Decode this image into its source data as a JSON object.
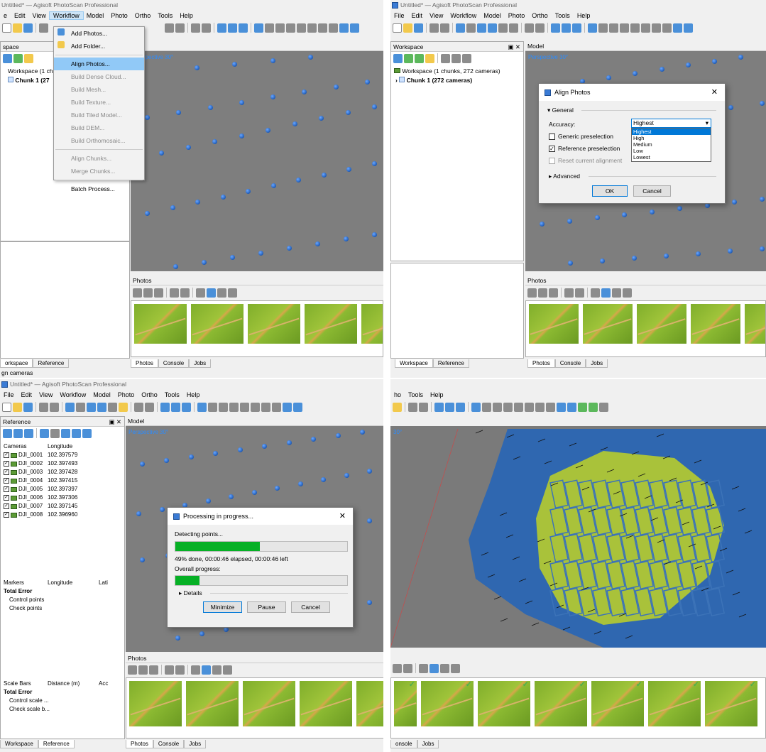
{
  "q1": {
    "title": "Untitled* — Agisoft PhotoScan Professional",
    "menu": [
      "e",
      "Edit",
      "View",
      "Workflow",
      "Model",
      "Photo",
      "Ortho",
      "Tools",
      "Help"
    ],
    "workspace_header": "space",
    "workspace_item": "Workspace (1 ch",
    "chunk_item": "Chunk 1 (27",
    "model_tab": "del",
    "perspective": "Perspective 30°",
    "photos_header": "Photos",
    "bottom_tabs_left": [
      "orkspace",
      "Reference"
    ],
    "bottom_tabs_right": [
      "Photos",
      "Console",
      "Jobs"
    ],
    "status": "gn cameras",
    "workflow_menu": {
      "add_photos": "Add Photos...",
      "add_folder": "Add Folder...",
      "align_photos": "Align Photos...",
      "build_dense": "Build Dense Cloud...",
      "build_mesh": "Build Mesh...",
      "build_texture": "Build Texture...",
      "build_tiled": "Build Tiled Model...",
      "build_dem": "Build DEM...",
      "build_ortho": "Build Orthomosaic...",
      "align_chunks": "Align Chunks...",
      "merge_chunks": "Merge Chunks...",
      "batch": "Batch Process..."
    }
  },
  "q2": {
    "title": "Untitled* — Agisoft PhotoScan Professional",
    "menu": [
      "File",
      "Edit",
      "View",
      "Workflow",
      "Model",
      "Photo",
      "Ortho",
      "Tools",
      "Help"
    ],
    "workspace_header": "Workspace",
    "header_ctl": "ع ×",
    "model_tab": "Model",
    "workspace_item": "Workspace (1 chunks, 272 cameras)",
    "chunk_item": "Chunk 1 (272 cameras)",
    "perspective": "Perspective 30°",
    "photos_header": "Photos",
    "bottom_tabs_left": [
      "Workspace",
      "Reference"
    ],
    "bottom_tabs_right": [
      "Photos",
      "Console",
      "Jobs"
    ],
    "dialog": {
      "title": "Align Photos",
      "general": "General",
      "accuracy_label": "Accuracy:",
      "accuracy_value": "Highest",
      "options": [
        "Highest",
        "High",
        "Medium",
        "Low",
        "Lowest"
      ],
      "generic": "Generic preselection",
      "reference": "Reference preselection",
      "reset": "Reset current alignment",
      "advanced": "Advanced",
      "ok": "OK",
      "cancel": "Cancel"
    }
  },
  "q3": {
    "title": "Untitled* — Agisoft PhotoScan Professional",
    "menu": [
      "File",
      "Edit",
      "View",
      "Workflow",
      "Model",
      "Photo",
      "Ortho",
      "Tools",
      "Help"
    ],
    "reference_header": "Reference",
    "model_tab": "Model",
    "perspective": "Perspective 30°",
    "cameras_cols": [
      "Cameras",
      "Longitude"
    ],
    "cameras": [
      {
        "name": "DJI_0001",
        "lon": "102.397579"
      },
      {
        "name": "DJI_0002",
        "lon": "102.397493"
      },
      {
        "name": "DJI_0003",
        "lon": "102.397428"
      },
      {
        "name": "DJI_0004",
        "lon": "102.397415"
      },
      {
        "name": "DJI_0005",
        "lon": "102.397397"
      },
      {
        "name": "DJI_0006",
        "lon": "102.397306"
      },
      {
        "name": "DJI_0007",
        "lon": "102.397145"
      },
      {
        "name": "DJI_0008",
        "lon": "102.396960"
      }
    ],
    "markers_cols": [
      "Markers",
      "Longitude",
      "Lati"
    ],
    "total_error": "Total Error",
    "control_points": "Control points",
    "check_points": "Check points",
    "scale_cols": [
      "Scale Bars",
      "Distance (m)",
      "Acc"
    ],
    "control_scale": "Control scale ...",
    "check_scale": "Check scale b...",
    "photos_header": "Photos",
    "bottom_tabs_left": [
      "Workspace",
      "Reference"
    ],
    "bottom_tabs_right": [
      "Photos",
      "Console",
      "Jobs"
    ],
    "progress": {
      "title": "Processing in progress...",
      "stage": "Detecting points...",
      "stage_fraction": 0.49,
      "stats": "49% done, 00:00:46 elapsed, 00:00:46 left",
      "overall_label": "Overall progress:",
      "overall_fraction": 0.14,
      "details": "Details",
      "minimize": "Minimize",
      "pause": "Pause",
      "cancel": "Cancel"
    }
  },
  "q4": {
    "menu": [
      "ho",
      "Tools",
      "Help"
    ],
    "perspective": "30°",
    "bottom_tabs_right": [
      "onsole",
      "Jobs"
    ]
  }
}
